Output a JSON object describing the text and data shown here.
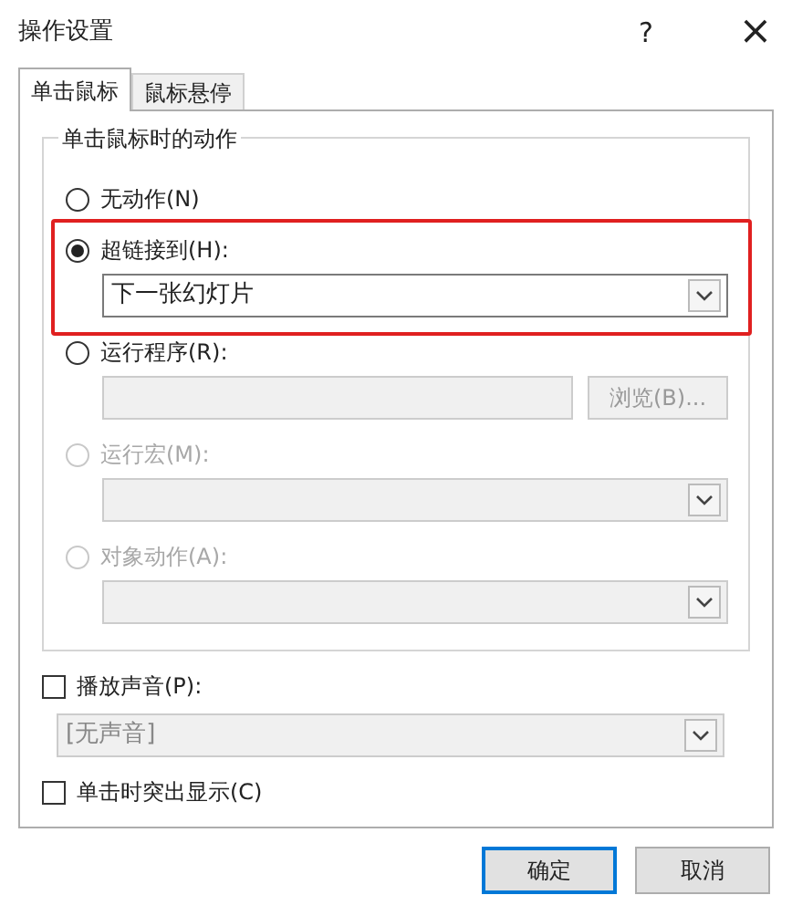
{
  "window": {
    "title": "操作设置",
    "help": "?",
    "close": "×"
  },
  "tabs": [
    {
      "label": "单击鼠标",
      "selected": true
    },
    {
      "label": "鼠标悬停",
      "selected": false
    }
  ],
  "group": {
    "label": "单击鼠标时的动作"
  },
  "actions": [
    {
      "kind": "none",
      "label": "无动作(N)",
      "selected": false,
      "disabled": false,
      "highlighted": false
    },
    {
      "kind": "dropdown",
      "label": "超链接到(H):",
      "selected": true,
      "disabled": false,
      "highlighted": true,
      "value": "下一张幻灯片",
      "control_disabled": false
    },
    {
      "kind": "field",
      "label": "运行程序(R):",
      "selected": false,
      "disabled": false,
      "highlighted": false,
      "button": "浏览(B)...",
      "control_disabled": true
    },
    {
      "kind": "dropdown",
      "label": "运行宏(M):",
      "selected": false,
      "disabled": true,
      "highlighted": false,
      "control_disabled": true
    },
    {
      "kind": "dropdown",
      "label": "对象动作(A):",
      "selected": false,
      "disabled": true,
      "highlighted": false,
      "control_disabled": true
    }
  ],
  "sound": {
    "label": "播放声音(P):",
    "checked": false,
    "value": "[无声音]",
    "disabled": true
  },
  "highlight_click": {
    "label": "单击时突出显示(C)",
    "checked": false
  },
  "buttons": [
    {
      "label": "确定",
      "default": true
    },
    {
      "label": "取消",
      "default": false
    }
  ]
}
